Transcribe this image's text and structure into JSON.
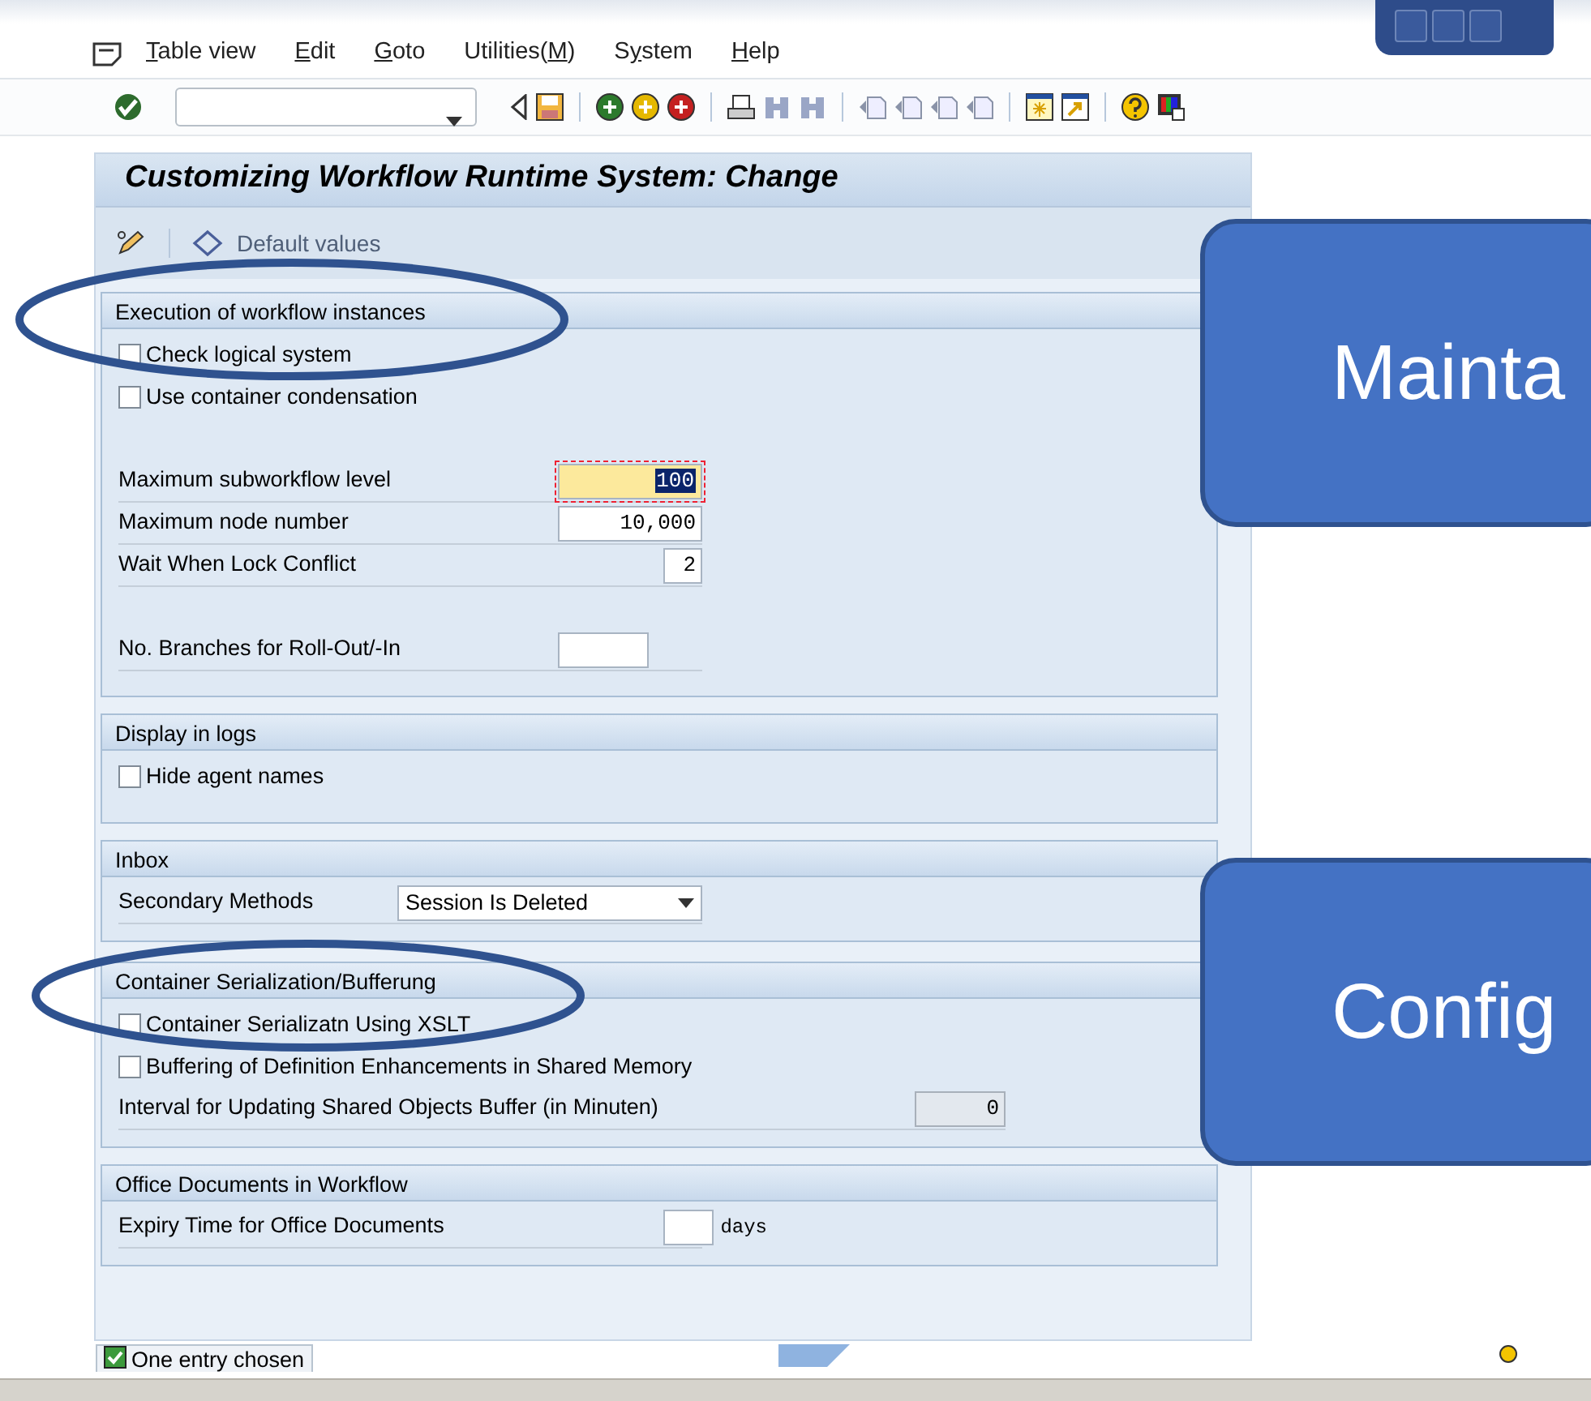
{
  "menu": [
    {
      "key": "T",
      "after": "able view"
    },
    {
      "key": "E",
      "after": "dit"
    },
    {
      "key": "G",
      "after": "oto"
    },
    {
      "before": "Utilities(",
      "key": "M",
      "after": ")"
    },
    {
      "before": "S",
      "key": "y",
      "after": "stem"
    },
    {
      "key": "H",
      "after": "elp"
    }
  ],
  "screen_title": "Customizing Workflow Runtime System: Change",
  "app_toolbar": {
    "button": "Default values"
  },
  "sections": [
    {
      "title": "Execution of workflow instances",
      "rows": [
        {
          "kind": "checkbox",
          "label": "Check logical system",
          "checked": false
        },
        {
          "kind": "checkbox",
          "label": "Use container condensation",
          "checked": false
        },
        {
          "kind": "gap"
        },
        {
          "kind": "field",
          "label": "Maximum subworkflow level",
          "value": "100",
          "focused": true
        },
        {
          "kind": "field",
          "label": "Maximum node number",
          "value": "10,000",
          "focused": false
        },
        {
          "kind": "field",
          "label": "Wait When Lock Conflict",
          "value": "2",
          "focused": false
        },
        {
          "kind": "gap"
        },
        {
          "kind": "field",
          "label": "No. Branches for Roll-Out/-In",
          "focused": false
        }
      ]
    },
    {
      "title": "Display in logs",
      "rows": [
        {
          "kind": "checkbox",
          "label": "Hide agent names",
          "checked": false
        }
      ]
    },
    {
      "title": "Inbox",
      "rows": [
        {
          "kind": "dropdown",
          "label": "Secondary Methods",
          "value": "Session Is Deleted"
        }
      ]
    },
    {
      "title": "Container Serialization/Bufferung",
      "rows": [
        {
          "kind": "checkbox",
          "label": "Container Serializatn Using XSLT",
          "checked": false
        },
        {
          "kind": "checkbox",
          "label": "Buffering of Definition Enhancements in Shared Memory",
          "checked": false
        },
        {
          "kind": "field",
          "label": "Interval for Updating Shared Objects Buffer (in Minuten)",
          "value": "0",
          "focused": false,
          "disabled": true
        }
      ]
    },
    {
      "title": "Office Documents in Workflow",
      "rows": [
        {
          "kind": "field",
          "label": "Expiry Time for Office Documents",
          "focused": false,
          "unit": "days"
        }
      ]
    }
  ],
  "status_bar": {
    "message": "One entry chosen"
  },
  "callouts": [
    {
      "text": "Mainta"
    },
    {
      "text": "Config"
    }
  ]
}
